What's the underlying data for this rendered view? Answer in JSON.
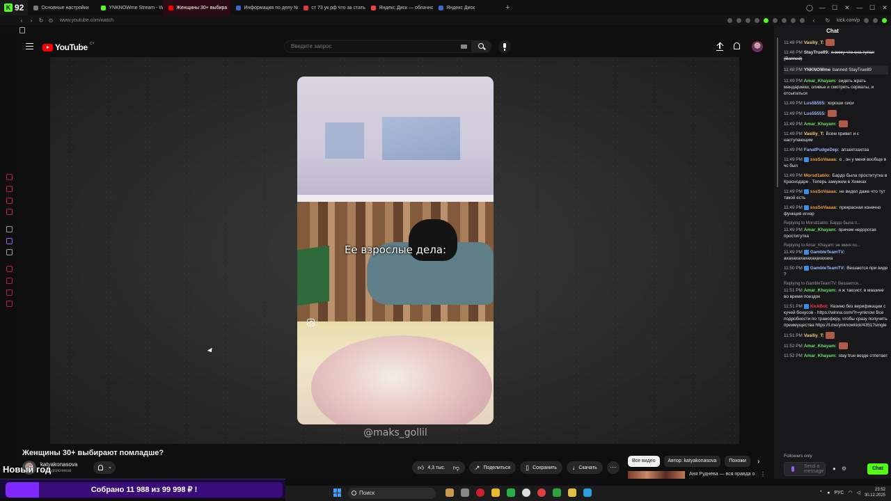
{
  "browser": {
    "kick_count": "92",
    "tabs": [
      {
        "label": "Основные настройки",
        "color": "#7a7a7a",
        "active": false
      },
      {
        "label": "YNKNOWme Stream - Wa",
        "color": "#53fc18",
        "active": false
      },
      {
        "label": "Женщины 30+ выбира",
        "color": "#ff0000",
        "active": true
      },
      {
        "label": "Информация по делу №",
        "color": "#3a6ad0",
        "active": false
      },
      {
        "label": "ст 73 ук рф что за статья",
        "color": "#e03a3a",
        "active": false
      },
      {
        "label": "Яндекс Диск — облачно",
        "color": "#f04040",
        "active": false
      },
      {
        "label": "Яндекс Диск",
        "color": "#3a6ad0",
        "active": false
      }
    ],
    "new_tab": "+",
    "url": "www.youtube.com/watch",
    "kick_url": "kick.com/p"
  },
  "youtube": {
    "logo_text": "YouTube",
    "logo_region": "CY",
    "search_placeholder": "Введите запрос",
    "video": {
      "caption": "Ее взрослые дела:",
      "watermark": "@maks_gollil",
      "title": "Женщины 30+ выбирают помладше?",
      "channel": "katyakonasova",
      "subscribers": "ны подписчиков",
      "likes": "4,3 тыс.",
      "share": "Поделиться",
      "save": "Сохранить",
      "download": "Скачать"
    },
    "chips": [
      "Все видео",
      "Автор: katyakonasova",
      "Похожи"
    ],
    "rec_title": "Аня Руднева — вся правда о"
  },
  "overlay": {
    "new_year": "Новый год",
    "donation_text": "Собрано 11 988  из 99 998 ₽ !",
    "donation_progress": 0.12
  },
  "chat": {
    "header": "Chat",
    "messages": [
      {
        "time": "11:48 PM",
        "user": "Vasiliy_T:",
        "color": "#f5d76e",
        "text": "",
        "emote": true
      },
      {
        "time": "11:48 PM",
        "user": "StayTrue89:",
        "color": "#e6e6e6",
        "text": "я вижу что она тупая (Banned)",
        "strike": true
      },
      {
        "time": "11:48 PM",
        "user": "YNKNOWme",
        "color": "#e6e6e6",
        "text": "banned StayTrue89",
        "highlight": true
      },
      {
        "time": "11:49 PM",
        "user": "Amar_Khayam:",
        "color": "#6be36b",
        "text": "сидеть жрать мандаринки, оливье и смотреть сериалы, и отсыпаться"
      },
      {
        "time": "11:49 PM",
        "user": "Lus55555:",
        "color": "#9ab8ff",
        "text": "хороши сиси"
      },
      {
        "time": "11:49 PM",
        "user": "Lus55555:",
        "color": "#9ab8ff",
        "text": "",
        "emote": true
      },
      {
        "time": "11:49 PM",
        "user": "Amar_Khayam:",
        "color": "#6be36b",
        "text": "",
        "emote": true
      },
      {
        "time": "11:49 PM",
        "user": "Vasiliy_T:",
        "color": "#f5d76e",
        "text": "Всем привет и с наступающим"
      },
      {
        "time": "11:49 PM",
        "user": "FanatPudgeDep:",
        "color": "#9ab8ff",
        "text": "апзахпзахпза"
      },
      {
        "time": "11:49 PM",
        "user": "sssSoVaaaa:",
        "color": "#f0a040",
        "text": "о , он у меня вообще в чс был",
        "badge": true
      },
      {
        "time": "11:49 PM",
        "user": "Morsd1ablo:",
        "color": "#f0a040",
        "text": "Бардо была проституткa в Краснодаре . Теперь замужем в Химках"
      },
      {
        "time": "11:49 PM",
        "user": "sssSoVaaaa:",
        "color": "#f0a040",
        "text": "не видел даже что тут такой есть",
        "badge": true
      },
      {
        "time": "11:49 PM",
        "user": "sssSoVaaaa:",
        "color": "#f0a040",
        "text": "прекрасная конечно функция игнор",
        "badge": true
      },
      {
        "time": "11:49 PM",
        "user": "Amar_Khayam:",
        "color": "#6be36b",
        "text": "причем недорогая проститутка",
        "reply": "Replying to Morsd1ablo: Бардо была п..."
      },
      {
        "time": "11:49 PM",
        "user": "GambleTeamTV:",
        "color": "#9ab8ff",
        "text": "ахахахахахахахахахаха",
        "reply": "Replying to Amar_Khayam: не меня по...",
        "badge": true
      },
      {
        "time": "11:50 PM",
        "user": "GambleTeamTV:",
        "color": "#9ab8ff",
        "text": "Вешаются при виде ?",
        "badge": true
      },
      {
        "time": "11:51 PM",
        "user": "Amar_Khayam:",
        "color": "#6be36b",
        "text": "я ж таксист, в машине во время поездок",
        "reply": "Replying to GambleTeamTV: Вешаются..."
      },
      {
        "time": "11:51 PM",
        "user": "KickBot:",
        "color": "#ff3355",
        "text": "Казино без верификации с кучей бонусов - https://winna.com/?r=ynknow  Все подробности по трансферу, чтобы сразу получить преимущества https://t.me/ynknowkick/4351?single",
        "badge": true
      },
      {
        "time": "11:51 PM",
        "user": "Vasiliy_T:",
        "color": "#f5d76e",
        "text": "",
        "emote": true
      },
      {
        "time": "11:52 PM",
        "user": "Amar_Khayam:",
        "color": "#6be36b",
        "text": "",
        "emote": true
      },
      {
        "time": "11:52 PM",
        "user": "Amar_Khayam:",
        "color": "#6be36b",
        "text": "stay true везде отпетает"
      }
    ],
    "followers_only": "Followers only",
    "send_placeholder": "Send a message",
    "chat_button": "Chat"
  },
  "taskbar": {
    "search": "Поиск",
    "lang": "РУС",
    "time": "23:52",
    "date": "30.12.2025"
  }
}
